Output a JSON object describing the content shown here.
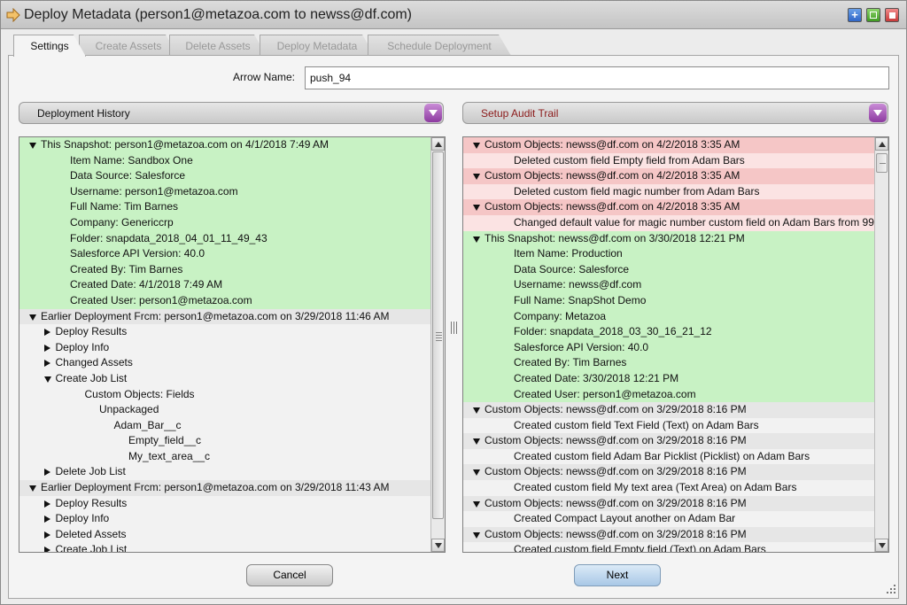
{
  "window": {
    "title": "Deploy Metadata (person1@metazoa.com to newss@df.com)"
  },
  "tabs": [
    {
      "label": "Settings",
      "active": true
    },
    {
      "label": "Create Assets",
      "active": false
    },
    {
      "label": "Delete Assets",
      "active": false
    },
    {
      "label": "Deploy Metadata",
      "active": false
    },
    {
      "label": "Schedule Deployment",
      "active": false
    }
  ],
  "arrow_name": {
    "label": "Arrow Name:",
    "value": "push_94"
  },
  "left_dropdown": {
    "selected": "Deployment History"
  },
  "right_dropdown": {
    "selected": "Setup Audit Trail"
  },
  "left_panel": {
    "rows": [
      {
        "text": "This Snapshot: person1@metazoa.com on 4/1/2018 7:49 AM",
        "level": 0,
        "toggle": "down",
        "bg": "green"
      },
      {
        "text": "Item Name: Sandbox One",
        "level": 2,
        "toggle": "",
        "bg": "green"
      },
      {
        "text": "Data Source: Salesforce",
        "level": 2,
        "toggle": "",
        "bg": "green"
      },
      {
        "text": "Username: person1@metazoa.com",
        "level": 2,
        "toggle": "",
        "bg": "green"
      },
      {
        "text": "Full Name: Tim Barnes",
        "level": 2,
        "toggle": "",
        "bg": "green"
      },
      {
        "text": "Company: Genericcrp",
        "level": 2,
        "toggle": "",
        "bg": "green"
      },
      {
        "text": "Folder: snapdata_2018_04_01_11_49_43",
        "level": 2,
        "toggle": "",
        "bg": "green"
      },
      {
        "text": "Salesforce API Version: 40.0",
        "level": 2,
        "toggle": "",
        "bg": "green"
      },
      {
        "text": "Created By: Tim Barnes",
        "level": 2,
        "toggle": "",
        "bg": "green"
      },
      {
        "text": "Created Date: 4/1/2018 7:49 AM",
        "level": 2,
        "toggle": "",
        "bg": "green"
      },
      {
        "text": "Created User: person1@metazoa.com",
        "level": 2,
        "toggle": "",
        "bg": "green"
      },
      {
        "text": "Earlier Deployment Frcm: person1@metazoa.com on 3/29/2018 11:46 AM",
        "level": 0,
        "toggle": "down",
        "bg": "grey"
      },
      {
        "text": "Deploy Results",
        "level": 1,
        "toggle": "right",
        "bg": "light"
      },
      {
        "text": "Deploy Info",
        "level": 1,
        "toggle": "right",
        "bg": "light"
      },
      {
        "text": "Changed Assets",
        "level": 1,
        "toggle": "right",
        "bg": "light"
      },
      {
        "text": "Create Job List",
        "level": 1,
        "toggle": "down",
        "bg": "light"
      },
      {
        "text": "Custom Objects: Fields",
        "level": 3,
        "toggle": "",
        "bg": "light"
      },
      {
        "text": "Unpackaged",
        "level": 4,
        "toggle": "",
        "bg": "light"
      },
      {
        "text": "Adam_Bar__c",
        "level": 5,
        "toggle": "",
        "bg": "light"
      },
      {
        "text": "Empty_field__c",
        "level": 6,
        "toggle": "",
        "bg": "light"
      },
      {
        "text": "My_text_area__c",
        "level": 6,
        "toggle": "",
        "bg": "light"
      },
      {
        "text": "Delete Job List",
        "level": 1,
        "toggle": "right",
        "bg": "light"
      },
      {
        "text": "Earlier Deployment Frcm: person1@metazoa.com on 3/29/2018 11:43 AM",
        "level": 0,
        "toggle": "down",
        "bg": "grey"
      },
      {
        "text": "Deploy Results",
        "level": 1,
        "toggle": "right",
        "bg": "light"
      },
      {
        "text": "Deploy Info",
        "level": 1,
        "toggle": "right",
        "bg": "light"
      },
      {
        "text": "Deleted Assets",
        "level": 1,
        "toggle": "right",
        "bg": "light"
      },
      {
        "text": "Create Job List",
        "level": 1,
        "toggle": "right",
        "bg": "light"
      }
    ]
  },
  "right_panel": {
    "rows": [
      {
        "text": "Custom Objects: newss@df.com on 4/2/2018 3:35 AM",
        "level": 0,
        "toggle": "down",
        "bg": "red"
      },
      {
        "text": "Deleted custom field Empty field from Adam Bars",
        "level": 2,
        "toggle": "",
        "bg": "pink"
      },
      {
        "text": "Custom Objects: newss@df.com on 4/2/2018 3:35 AM",
        "level": 0,
        "toggle": "down",
        "bg": "red"
      },
      {
        "text": "Deleted custom field magic number from Adam Bars",
        "level": 2,
        "toggle": "",
        "bg": "pink"
      },
      {
        "text": "Custom Objects: newss@df.com on 4/2/2018 3:35 AM",
        "level": 0,
        "toggle": "down",
        "bg": "red"
      },
      {
        "text": "Changed default value for magic number custom field on Adam Bars from 99",
        "level": 2,
        "toggle": "",
        "bg": "pink"
      },
      {
        "text": "This Snapshot: newss@df.com on 3/30/2018 12:21 PM",
        "level": 0,
        "toggle": "down",
        "bg": "green"
      },
      {
        "text": "Item Name: Production",
        "level": 2,
        "toggle": "",
        "bg": "green"
      },
      {
        "text": "Data Source: Salesforce",
        "level": 2,
        "toggle": "",
        "bg": "green"
      },
      {
        "text": "Username: newss@df.com",
        "level": 2,
        "toggle": "",
        "bg": "green"
      },
      {
        "text": "Full Name: SnapShot Demo",
        "level": 2,
        "toggle": "",
        "bg": "green"
      },
      {
        "text": "Company: Metazoa",
        "level": 2,
        "toggle": "",
        "bg": "green"
      },
      {
        "text": "Folder: snapdata_2018_03_30_16_21_12",
        "level": 2,
        "toggle": "",
        "bg": "green"
      },
      {
        "text": "Salesforce API Version: 40.0",
        "level": 2,
        "toggle": "",
        "bg": "green"
      },
      {
        "text": "Created By: Tim Barnes",
        "level": 2,
        "toggle": "",
        "bg": "green"
      },
      {
        "text": "Created Date: 3/30/2018 12:21 PM",
        "level": 2,
        "toggle": "",
        "bg": "green"
      },
      {
        "text": "Created User: person1@metazoa.com",
        "level": 2,
        "toggle": "",
        "bg": "green"
      },
      {
        "text": "Custom Objects: newss@df.com on 3/29/2018 8:16 PM",
        "level": 0,
        "toggle": "down",
        "bg": "grey"
      },
      {
        "text": "Created custom field Text Field (Text) on Adam Bars",
        "level": 2,
        "toggle": "",
        "bg": "light"
      },
      {
        "text": "Custom Objects: newss@df.com on 3/29/2018 8:16 PM",
        "level": 0,
        "toggle": "down",
        "bg": "grey"
      },
      {
        "text": "Created custom field Adam Bar Picklist (Picklist) on Adam Bars",
        "level": 2,
        "toggle": "",
        "bg": "light"
      },
      {
        "text": "Custom Objects: newss@df.com on 3/29/2018 8:16 PM",
        "level": 0,
        "toggle": "down",
        "bg": "grey"
      },
      {
        "text": "Created custom field My text area (Text Area) on Adam Bars",
        "level": 2,
        "toggle": "",
        "bg": "light"
      },
      {
        "text": "Custom Objects: newss@df.com on 3/29/2018 8:16 PM",
        "level": 0,
        "toggle": "down",
        "bg": "grey"
      },
      {
        "text": "Created Compact Layout another on Adam Bar",
        "level": 2,
        "toggle": "",
        "bg": "light"
      },
      {
        "text": "Custom Objects: newss@df.com on 3/29/2018 8:16 PM",
        "level": 0,
        "toggle": "down",
        "bg": "grey"
      },
      {
        "text": "Created custom field Empty field (Text) on Adam Bars",
        "level": 2,
        "toggle": "",
        "bg": "light"
      }
    ]
  },
  "buttons": {
    "cancel": "Cancel",
    "next": "Next"
  },
  "colors": {
    "snapshot_green": "#c8f2c4",
    "audit_red": "#f5c6c6",
    "audit_pink": "#fbe3e3",
    "dropdown_purple": "#8d3aa0",
    "next_blue": "#a9c8e6"
  },
  "icons": {
    "title": "deploy-arrow-icon",
    "maximize": "plus-icon",
    "restore": "square-icon",
    "close": "stop-icon"
  }
}
